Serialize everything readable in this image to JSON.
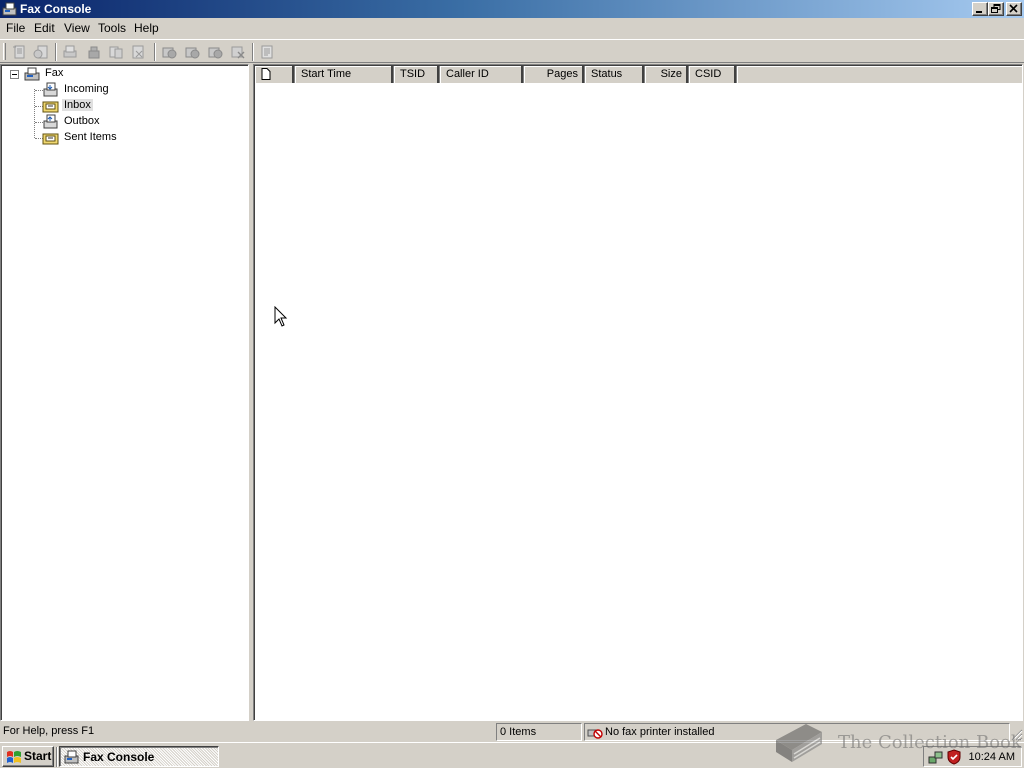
{
  "window": {
    "title": "Fax Console"
  },
  "menu": {
    "items": [
      "File",
      "Edit",
      "View",
      "Tools",
      "Help"
    ]
  },
  "toolbar": {
    "icons": [
      "new-fax-icon",
      "receive-fax-icon",
      "view-fax-icon",
      "print-fax-icon",
      "save-fax-icon",
      "mail-fax-icon",
      "pause-fax-icon",
      "resume-fax-icon",
      "restart-fax-icon",
      "delete-fax-icon",
      "properties-icon"
    ]
  },
  "tree": {
    "root": "Fax",
    "children": [
      "Incoming",
      "Inbox",
      "Outbox",
      "Sent Items"
    ],
    "selected": "Inbox"
  },
  "list": {
    "columns": [
      "",
      "Start Time",
      "TSID",
      "Caller ID",
      "Pages",
      "Status",
      "Size",
      "CSID"
    ],
    "rows": []
  },
  "statusbar": {
    "help": "For Help, press F1",
    "items": "0 Items",
    "printer": "No fax printer installed"
  },
  "taskbar": {
    "start": "Start",
    "task": "Fax Console",
    "clock": "10:24 AM"
  },
  "watermark": {
    "text": "The Collection Book"
  },
  "colors": {
    "titlebar_start": "#0a246a",
    "titlebar_end": "#a6caf0",
    "face": "#d4d0c8"
  }
}
